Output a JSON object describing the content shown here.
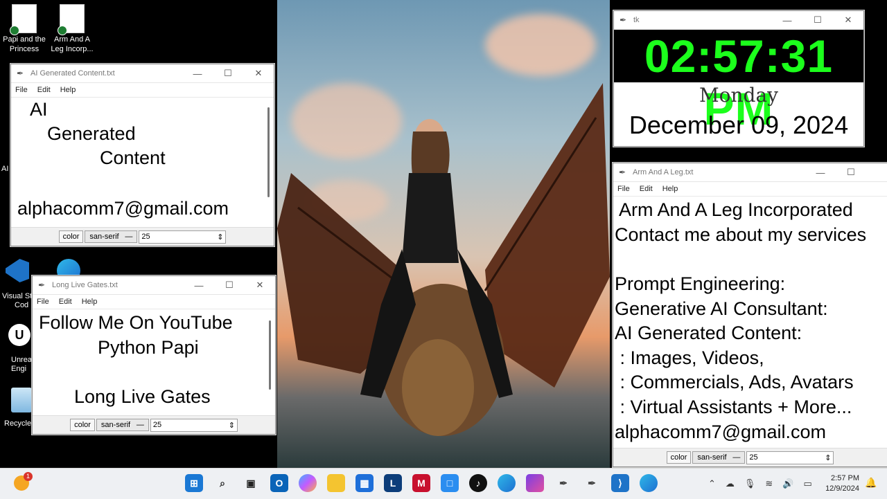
{
  "desktop_icons": [
    {
      "label_line1": "Papi and the",
      "label_line2": "Princess"
    },
    {
      "label_line1": "Arm And A",
      "label_line2": "Leg Incorp..."
    }
  ],
  "left_partial_labels": {
    "ai": "AI",
    "vscode_1": "Visual St",
    "vscode_2": "Cod",
    "unreal_1": "Unrea",
    "unreal_2": "Engi",
    "recycle": "Recycle"
  },
  "win_ai": {
    "title": "AI Generated Content.txt",
    "menu": [
      "File",
      "Edit",
      "Help"
    ],
    "lines": [
      "AI",
      "Generated",
      "Content",
      "",
      "alphacomm7@gmail.com"
    ],
    "color_btn": "color",
    "font": "san-serif",
    "size": "25"
  },
  "win_gates": {
    "title": "Long Live Gates.txt",
    "menu": [
      "File",
      "Edit",
      "Help"
    ],
    "lines": [
      "Follow Me On YouTube",
      "Python Papi",
      "",
      "Long Live Gates"
    ],
    "color_btn": "color",
    "font": "san-serif",
    "size": "25"
  },
  "win_clock": {
    "title": "tk",
    "time": "02:57:31 PM",
    "day": "Monday",
    "date": "December 09, 2024",
    "time_color": "#1cff1c"
  },
  "win_arm": {
    "title": "Arm And A Leg.txt",
    "menu": [
      "File",
      "Edit",
      "Help"
    ],
    "lines": [
      " Arm And A Leg Incorporated",
      "Contact me about my services",
      "",
      "Prompt Engineering:",
      "Generative AI Consultant:",
      "AI Generated Content:",
      " : Images, Videos,",
      " : Commercials, Ads, Avatars",
      " : Virtual Assistants + More...",
      "alphacomm7@gmail.com"
    ],
    "color_btn": "color",
    "font": "san-serif",
    "size": "25"
  },
  "taskbar": {
    "notification_badge": "1",
    "time": "2:57 PM",
    "date": "12/9/2024",
    "icons": [
      "windows-start",
      "search",
      "task-view",
      "outlook",
      "copilot",
      "file-explorer",
      "store",
      "l-app",
      "mcafee",
      "app-square",
      "tiktok",
      "edge",
      "clipchamp",
      "feather-1",
      "feather-2",
      "vscode",
      "edge-2"
    ]
  }
}
